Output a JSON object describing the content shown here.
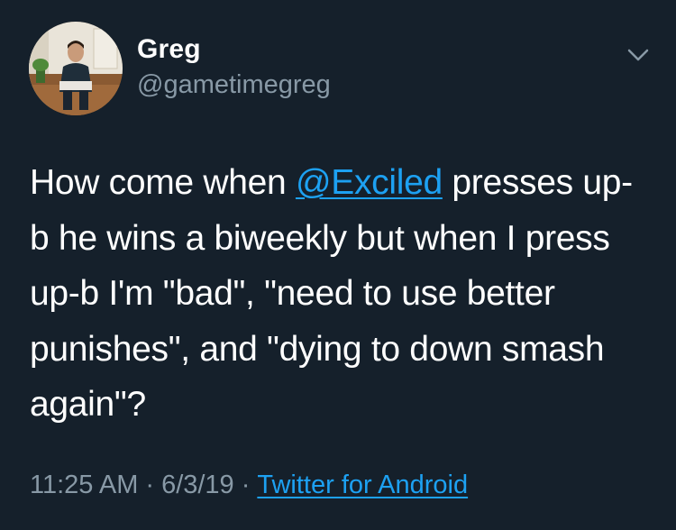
{
  "author": {
    "display_name": "Greg",
    "handle": "@gametimegreg"
  },
  "icons": {
    "menu": "chevron-down-icon",
    "avatar": "profile-photo"
  },
  "tweet": {
    "text_before_mention": "How come when ",
    "mention": "@Exciled",
    "text_after_mention": " presses up-b he wins a biweekly but when I press up-b I'm \"bad\", \"need to use better punishes\", and \"dying to down smash again\"?"
  },
  "meta": {
    "time": "11:25 AM",
    "separator": "·",
    "date": "6/3/19",
    "source": "Twitter for Android"
  },
  "colors": {
    "background": "#15202b",
    "text": "#ffffff",
    "secondary": "#8899a6",
    "link": "#1da1f2"
  }
}
